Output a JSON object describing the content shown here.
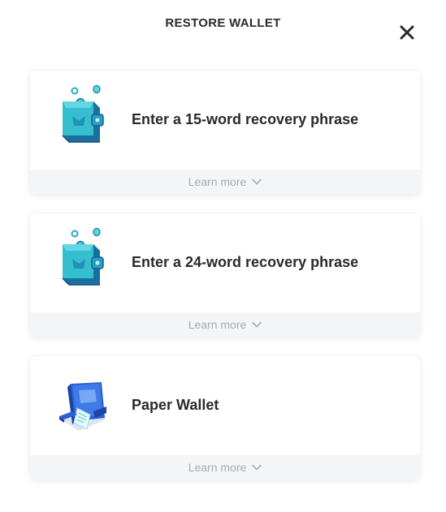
{
  "header": {
    "title": "RESTORE WALLET",
    "close_icon": "close-icon"
  },
  "options": [
    {
      "label": "Enter a 15-word recovery phrase",
      "footer_label": "Learn more",
      "icon": "wallet-coins-icon"
    },
    {
      "label": "Enter a 24-word recovery phrase",
      "footer_label": "Learn more",
      "icon": "wallet-coins-icon"
    },
    {
      "label": "Paper Wallet",
      "footer_label": "Learn more",
      "icon": "paper-wallet-printer-icon"
    }
  ],
  "colors": {
    "text": "#2a2a2a",
    "muted": "#a7abb3",
    "footer_bg": "#f4f5f7",
    "teal": "#27b7c6",
    "blue": "#2a5fd4"
  }
}
